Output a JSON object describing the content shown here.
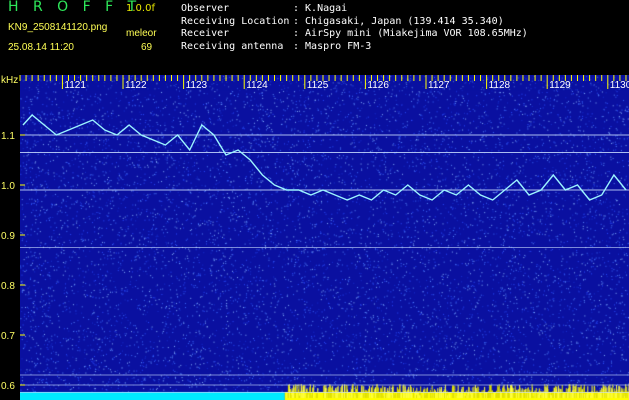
{
  "header": {
    "app_title": "H R O F F T",
    "version": "1.0.0f",
    "filename": "KN9_2508141120.png",
    "timestamp": "25.08.14 11:20",
    "mode_label": "meleor",
    "mode_value": "69",
    "info": [
      {
        "key": "Observer",
        "value": ": K.Nagai"
      },
      {
        "key": "Receiving Location",
        "value": ": Chigasaki, Japan (139.414 35.340)"
      },
      {
        "key": "Receiver",
        "value": ": AirSpy mini (Miakejima VOR 108.65MHz)"
      },
      {
        "key": "Receiving antenna",
        "value": ": Maspro FM-3"
      }
    ]
  },
  "chart_data": {
    "type": "heatmap",
    "ylabel": "kHz",
    "y_ticks": [
      "1.1",
      "1.0",
      "0.9",
      "0.8",
      "0.7",
      "0.6"
    ],
    "y_tick_values": [
      1.1,
      1.0,
      0.9,
      0.8,
      0.7,
      0.6
    ],
    "ylim": [
      0.57,
      1.22
    ],
    "x_ticks": [
      "1121",
      "1122",
      "1123",
      "1124",
      "1125",
      "1126",
      "1127",
      "1128",
      "1129",
      "1130"
    ],
    "x_tick_values": [
      1121,
      1122,
      1123,
      1124,
      1125,
      1126,
      1127,
      1128,
      1129,
      1130
    ],
    "xlim": [
      1120.3,
      1130.35
    ],
    "trace": {
      "x": [
        1120.35,
        1120.5,
        1120.7,
        1120.9,
        1121.1,
        1121.3,
        1121.5,
        1121.7,
        1121.9,
        1122.1,
        1122.3,
        1122.5,
        1122.7,
        1122.9,
        1123.1,
        1123.3,
        1123.5,
        1123.7,
        1123.9,
        1124.1,
        1124.3,
        1124.5,
        1124.7,
        1124.9,
        1125.1,
        1125.3,
        1125.5,
        1125.7,
        1125.9,
        1126.1,
        1126.3,
        1126.5,
        1126.7,
        1126.9,
        1127.1,
        1127.3,
        1127.5,
        1127.7,
        1127.9,
        1128.1,
        1128.3,
        1128.5,
        1128.7,
        1128.9,
        1129.1,
        1129.3,
        1129.5,
        1129.7,
        1129.9,
        1130.1,
        1130.3
      ],
      "y": [
        1.12,
        1.14,
        1.12,
        1.1,
        1.11,
        1.12,
        1.13,
        1.11,
        1.1,
        1.12,
        1.1,
        1.09,
        1.08,
        1.1,
        1.07,
        1.12,
        1.1,
        1.06,
        1.07,
        1.05,
        1.02,
        1.0,
        0.99,
        0.99,
        0.98,
        0.99,
        0.98,
        0.97,
        0.98,
        0.97,
        0.99,
        0.98,
        1.0,
        0.98,
        0.97,
        0.99,
        0.98,
        1.0,
        0.98,
        0.97,
        0.99,
        1.01,
        0.98,
        0.99,
        1.02,
        0.99,
        1.0,
        0.97,
        0.98,
        1.02,
        0.99
      ]
    },
    "hlines": [
      1.1,
      1.065,
      0.99,
      0.875,
      0.62,
      0.6,
      0.585
    ],
    "colors": {
      "background": "#0a10a0",
      "noise": "#3c6cff",
      "trace": "#9cf4ff",
      "hline": "#c8dcff",
      "tick": "#ffff00",
      "bottom_band_left": "#00eaff",
      "bottom_band_right": "#ffff00"
    }
  }
}
